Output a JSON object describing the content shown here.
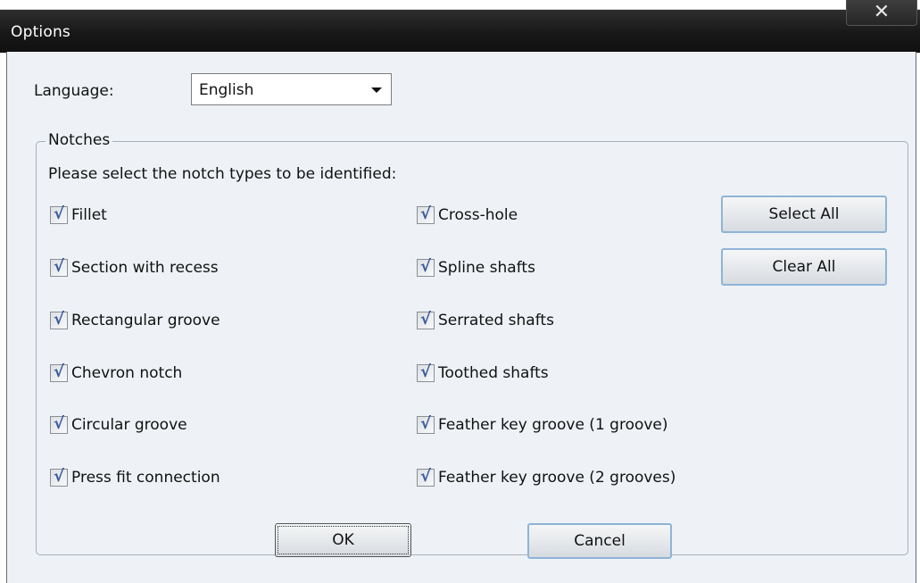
{
  "window": {
    "title": "Options",
    "close_glyph": "✕"
  },
  "language": {
    "label": "Language:",
    "selected": "English"
  },
  "notches": {
    "legend": "Notches",
    "instruction": "Please select the notch types to be identified:",
    "left_column": [
      {
        "label": "Fillet",
        "checked": true
      },
      {
        "label": "Section with recess",
        "checked": true
      },
      {
        "label": "Rectangular groove",
        "checked": true
      },
      {
        "label": "Chevron notch",
        "checked": true
      },
      {
        "label": "Circular groove",
        "checked": true
      },
      {
        "label": "Press fit connection",
        "checked": true
      }
    ],
    "right_column": [
      {
        "label": "Cross-hole",
        "checked": true
      },
      {
        "label": "Spline shafts",
        "checked": true
      },
      {
        "label": "Serrated shafts",
        "checked": true
      },
      {
        "label": "Toothed shafts",
        "checked": true
      },
      {
        "label": "Feather key groove (1 groove)",
        "checked": true
      },
      {
        "label": "Feather key groove (2 grooves)",
        "checked": true
      }
    ],
    "select_all_label": "Select All",
    "clear_all_label": "Clear All"
  },
  "footer": {
    "ok_label": "OK",
    "cancel_label": "Cancel"
  },
  "icons": {
    "close": "close-icon",
    "dropdown": "chevron-down-icon",
    "check": "checkmark-icon"
  },
  "check_glyph": "√"
}
